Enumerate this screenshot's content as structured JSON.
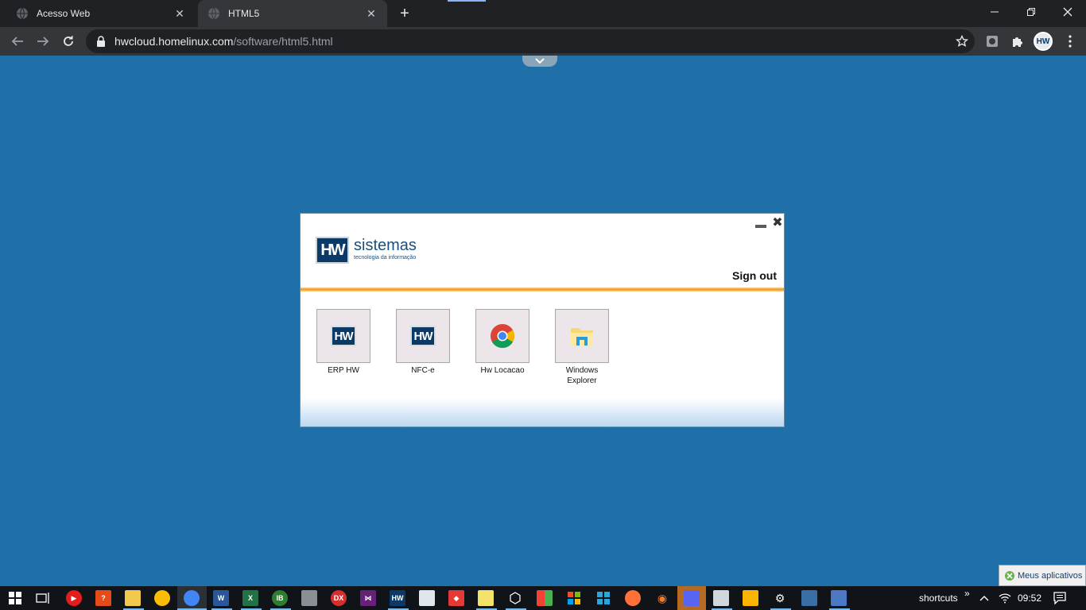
{
  "browser": {
    "tabs": [
      {
        "title": "Acesso Web",
        "active": false
      },
      {
        "title": "HTML5",
        "active": true
      }
    ],
    "url_host": "hwcloud.homelinux.com",
    "url_path": "/software/html5.html",
    "profile_initials": "HW"
  },
  "dialog": {
    "logo_mark": "HW",
    "logo_name": "sistemas",
    "logo_tagline": "tecnologia da informação",
    "signout_label": "Sign out",
    "apps": [
      {
        "label": "ERP HW",
        "icon": "hw-logo-icon"
      },
      {
        "label": "NFC-e",
        "icon": "hw-logo-icon"
      },
      {
        "label": "Hw Locacao",
        "icon": "chrome-icon"
      },
      {
        "label": "Windows Explorer",
        "icon": "folder-icon"
      }
    ]
  },
  "meus_aplicativos": "Meus aplicativos",
  "taskbar": {
    "tray_label": "shortcuts",
    "tray_chevron": "»",
    "time": "09:52"
  },
  "colors": {
    "desktop_bg": "#1f6fa8",
    "hw_blue": "#0c3a66",
    "accent_orange": "#ee9a2a"
  }
}
